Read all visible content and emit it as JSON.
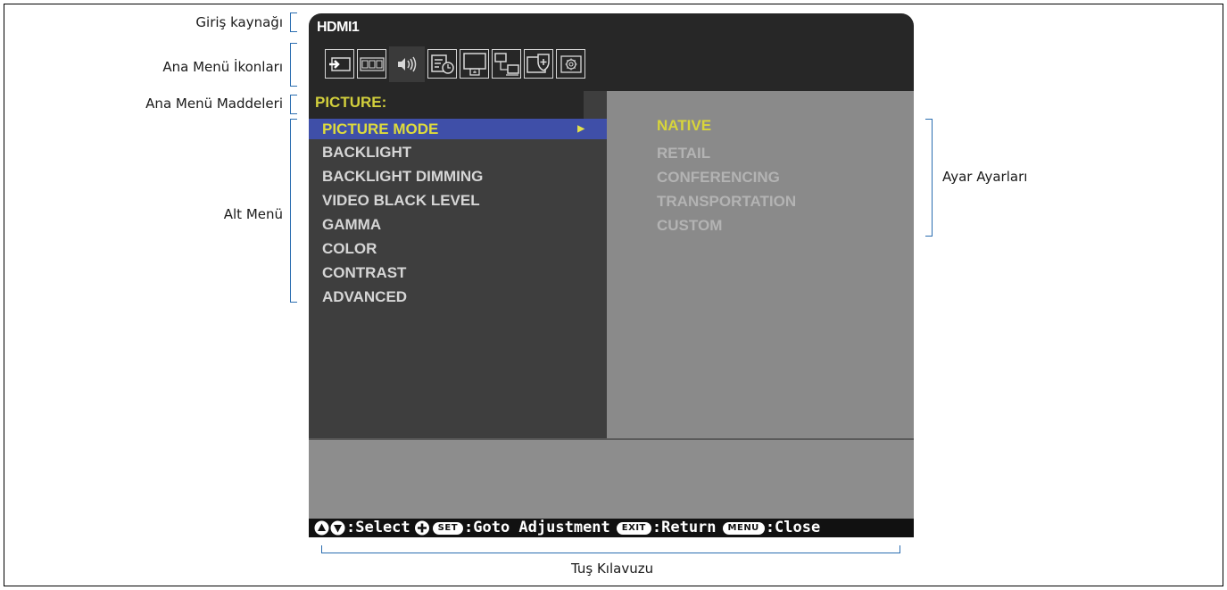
{
  "annotations": {
    "input_source": "Giriş kaynağı",
    "main_menu_icons": "Ana Menü İkonları",
    "main_menu_items": "Ana Menü Maddeleri",
    "sub_menu": "Alt Menü",
    "adjust_settings": "Ayar Ayarları",
    "key_guide": "Tuş Kılavuzu"
  },
  "osd": {
    "input_name": "HDMI1",
    "icons": [
      "input-icon",
      "rgb-icon",
      "audio-icon",
      "schedule-icon",
      "multi-input-icon",
      "network-icon",
      "protect-icon",
      "system-icon"
    ],
    "menu_title": "PICTURE:",
    "sub_menu": [
      {
        "label": "PICTURE MODE",
        "selected": true
      },
      {
        "label": "BACKLIGHT"
      },
      {
        "label": "BACKLIGHT DIMMING"
      },
      {
        "label": "VIDEO BLACK LEVEL"
      },
      {
        "label": "GAMMA"
      },
      {
        "label": "COLOR"
      },
      {
        "label": "CONTRAST"
      },
      {
        "label": "ADVANCED"
      }
    ],
    "options": [
      {
        "label": "NATIVE",
        "selected": true
      },
      {
        "label": "RETAIL"
      },
      {
        "label": "CONFERENCING"
      },
      {
        "label": "TRANSPORTATION"
      },
      {
        "label": "CUSTOM"
      }
    ],
    "key_guide": {
      "select": ":Select",
      "set_pill": "SET",
      "goto": ":Goto Adjustment",
      "exit_pill": "EXIT",
      "return": ":Return",
      "menu_pill": "MENU",
      "close": ":Close"
    }
  },
  "colors": {
    "highlight_bg": "#3f4fa8",
    "highlight_text": "#dedb3c",
    "bracket": "#2a6db0"
  }
}
